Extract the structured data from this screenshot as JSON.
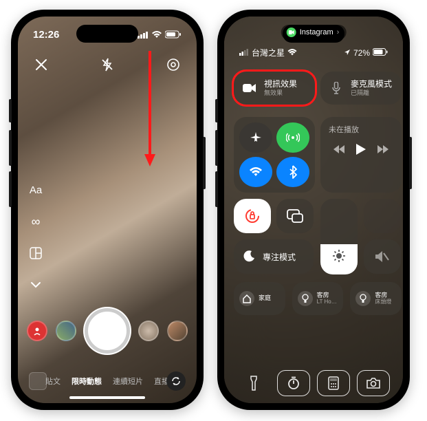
{
  "left": {
    "time": "12:26",
    "tools": {
      "text": "Aa",
      "infinity": "∞"
    },
    "modes": {
      "post": "貼文",
      "story": "限時動態",
      "reels": "連續短片",
      "live": "直播"
    }
  },
  "right": {
    "pill_app": "Instagram",
    "carrier": "台灣之星",
    "battery": "72%",
    "tiles": {
      "video_effect": {
        "title": "視訊效果",
        "sub": "無效果"
      },
      "mic_mode": {
        "title": "麥克風模式",
        "sub": "已隔離"
      },
      "media_title": "未在播放",
      "focus": "專注模式",
      "home_main": "家庭",
      "home1": {
        "l1": "客房",
        "l2": "LT Ho…"
      },
      "home2": {
        "l1": "客房",
        "l2": "床頭燈"
      }
    }
  }
}
